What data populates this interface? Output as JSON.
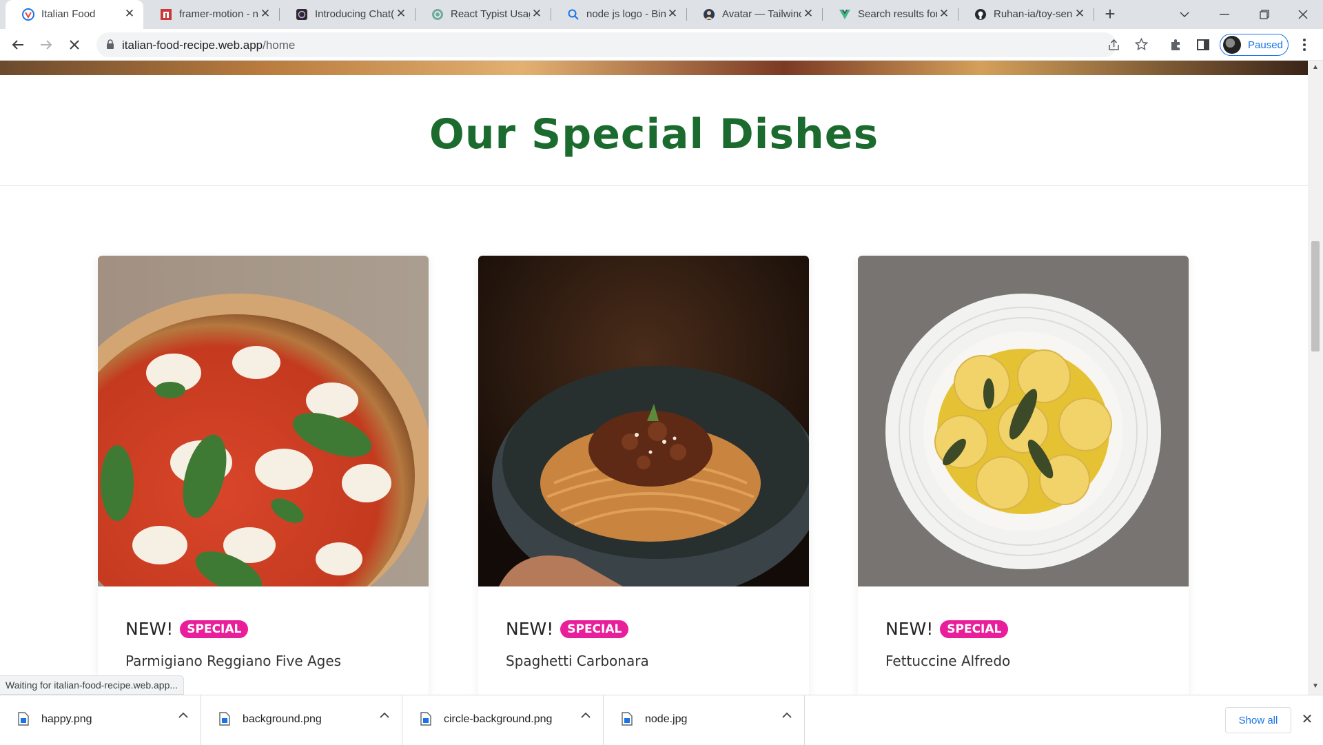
{
  "browser": {
    "tabs": [
      {
        "title": "Italian Food",
        "active": true,
        "icon": "italian-food-favicon"
      },
      {
        "title": "framer-motion - n",
        "icon": "npm-icon"
      },
      {
        "title": "Introducing Chat(",
        "icon": "openai-icon"
      },
      {
        "title": "React Typist Usag",
        "icon": "chatgpt-icon"
      },
      {
        "title": "node js logo - Bin",
        "icon": "bing-search-icon"
      },
      {
        "title": "Avatar — Tailwinc",
        "icon": "tailwind-avatar-icon"
      },
      {
        "title": "Search results for",
        "icon": "vue-search-icon"
      },
      {
        "title": "Ruhan-ia/toy-sen",
        "icon": "github-icon"
      }
    ],
    "url_host": "italian-food-recipe.web.app",
    "url_path": "/home",
    "profile_label": "Paused",
    "status_text": "Waiting for italian-food-recipe.web.app..."
  },
  "page": {
    "heading": "Our Special Dishes",
    "cards": [
      {
        "new_label": "NEW!",
        "badge": "SPECIAL",
        "dish": "Parmigiano Reggiano Five Ages",
        "image": "margherita-pizza-photo"
      },
      {
        "new_label": "NEW!",
        "badge": "SPECIAL",
        "dish": "Spaghetti Carbonara",
        "image": "spaghetti-bowl-photo"
      },
      {
        "new_label": "NEW!",
        "badge": "SPECIAL",
        "dish": "Fettuccine Alfredo",
        "image": "ravioli-plate-photo"
      }
    ]
  },
  "downloads": {
    "items": [
      "happy.png",
      "background.png",
      "circle-background.png",
      "node.jpg"
    ],
    "show_all_label": "Show all"
  },
  "colors": {
    "heading": "#1b6b2f",
    "badge": "#e91e9a",
    "accent_blue": "#1a73e8"
  }
}
